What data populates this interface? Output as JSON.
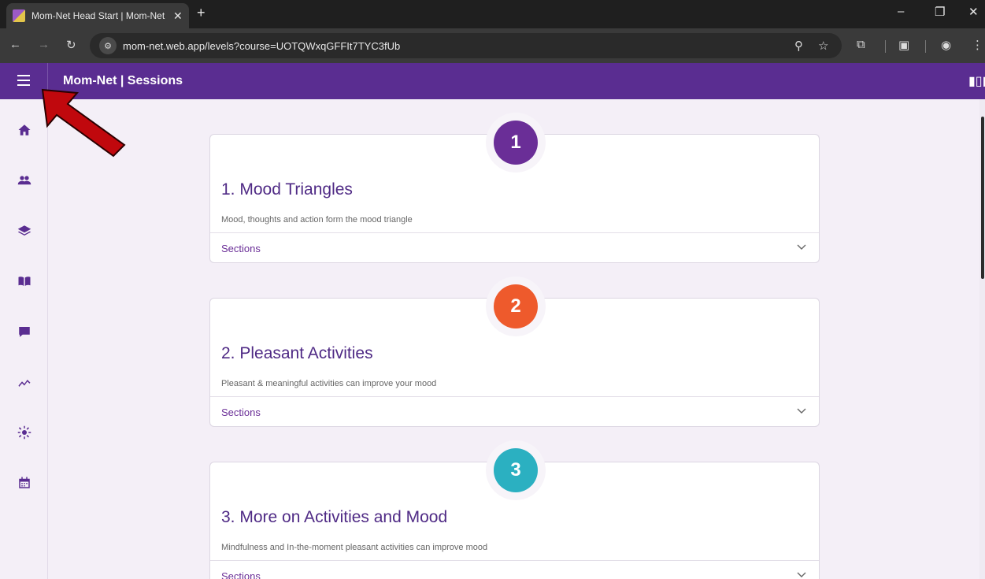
{
  "browser": {
    "tab_title": "Mom-Net Head Start | Mom-Net",
    "tab_close": "✕",
    "new_tab": "+",
    "url": "mom-net.web.app/levels?course=UOTQWxqGFFIt7TYC3fUb",
    "window_controls": {
      "minimize": "–",
      "restore": "❐",
      "close": "✕"
    }
  },
  "app": {
    "title": "Mom-Net | Sessions",
    "library_icon": "library-icon"
  },
  "sidebar": {
    "items": [
      "home-icon",
      "people-icon",
      "layers-icon",
      "book-icon",
      "chat-icon",
      "trend-icon",
      "sun-icon",
      "calendar-icon"
    ]
  },
  "sessions": [
    {
      "number": "1",
      "title": "1. Mood Triangles",
      "description": "Mood, thoughts and action form the mood triangle",
      "sections_label": "Sections",
      "color": "#6a2e97"
    },
    {
      "number": "2",
      "title": "2. Pleasant Activities",
      "description": "Pleasant & meaningful activities can improve your mood",
      "sections_label": "Sections",
      "color": "#ee5a2c"
    },
    {
      "number": "3",
      "title": "3. More on Activities and Mood",
      "description": "Mindfulness and In-the-moment pleasant activities can improve mood",
      "sections_label": "Sections",
      "color": "#2bb0c1"
    }
  ],
  "colors": {
    "appbar": "#5a2d91",
    "accent": "#6a2e97",
    "arrow": "#c0080d"
  }
}
